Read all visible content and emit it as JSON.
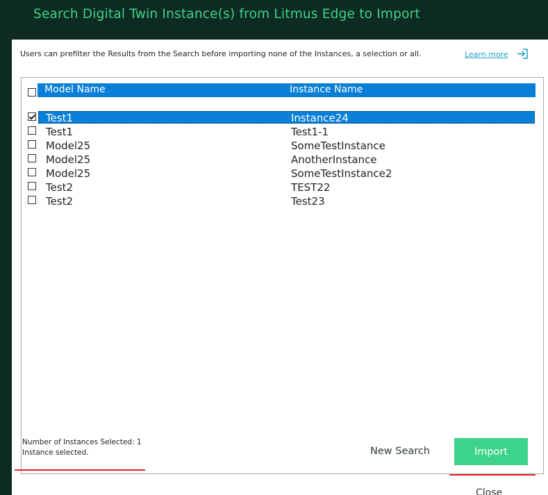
{
  "dialog": {
    "title": "Search Digital Twin Instance(s) from Litmus Edge to Import",
    "description": "Users can prefilter the Results from the Search before importing none of the Instances, a selection or all.",
    "learn_more": "Learn more",
    "learn_more_icon": "exit-arrow-icon"
  },
  "table": {
    "columns": [
      "Model Name",
      "Instance Name"
    ],
    "rows": [
      {
        "model": "Test1",
        "instance": "Instance24",
        "checked": true,
        "selected": true
      },
      {
        "model": "Test1",
        "instance": "Test1-1",
        "checked": false,
        "selected": false
      },
      {
        "model": "Model25",
        "instance": "SomeTestInstance",
        "checked": false,
        "selected": false
      },
      {
        "model": "Model25",
        "instance": "AnotherInstance",
        "checked": false,
        "selected": false
      },
      {
        "model": "Model25",
        "instance": "SomeTestInstance2",
        "checked": false,
        "selected": false
      },
      {
        "model": "Test2",
        "instance": "TEST22",
        "checked": false,
        "selected": false
      },
      {
        "model": "Test2",
        "instance": "Test23",
        "checked": false,
        "selected": false
      }
    ]
  },
  "status": {
    "line1": "Number of Instances Selected: 1",
    "line2": "Instance selected."
  },
  "buttons": {
    "new_search": "New Search",
    "import": "Import",
    "close": "Close"
  },
  "colors": {
    "title_text": "#3ed38a",
    "background": "#0e2b23",
    "selection": "#0a7fd8",
    "import_button": "#3ed38a",
    "annotation": "#e02020"
  }
}
